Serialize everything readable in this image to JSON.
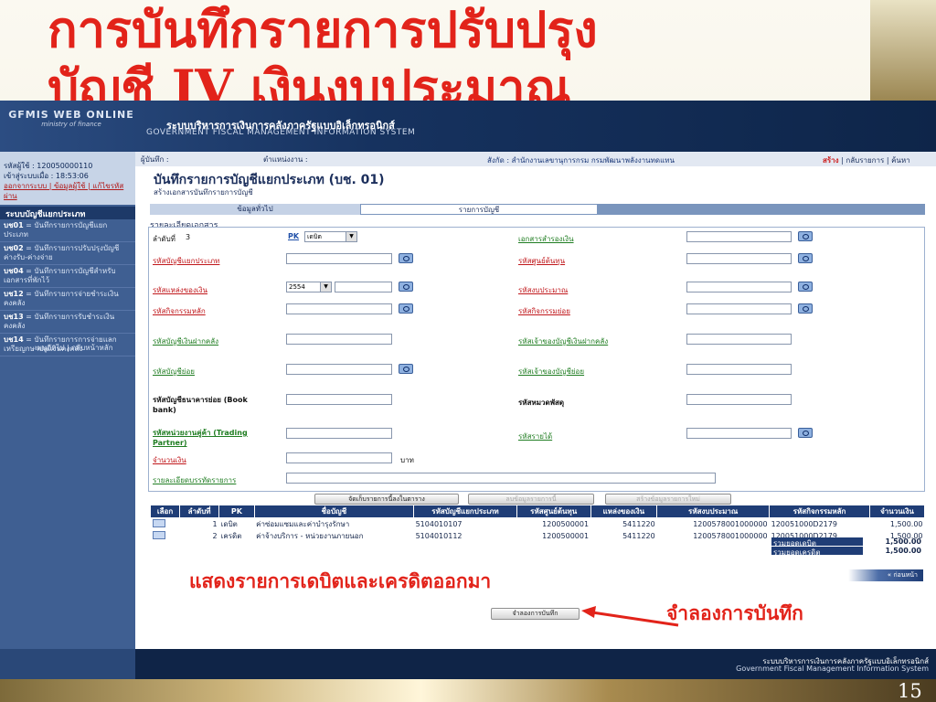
{
  "slide": {
    "title_line1": "การบันทึกรายการปรับปรุง",
    "title_line2": "บัญชี JV เงินงบประมาณ",
    "page_number": "15",
    "note_debit_credit": "แสดงรายการเดบิตและเครดิตออกมา",
    "note_simulate": "จำลองการบันทึก"
  },
  "header": {
    "logo_main": "GFMIS WEB ONLINE",
    "logo_sub": "ministry of finance",
    "system_th": "ระบบบริหารการเงินการคลังภาครัฐแบบอิเล็กทรอนิกส์",
    "system_en": "GOVERNMENT FISCAL MANAGEMENT INFORMATION SYSTEM"
  },
  "sidebar": {
    "user_label": "รหัสผู้ใช้ : 120050000110",
    "login_time": "เข้าสู่ระบบเมื่อ : 18:53:06",
    "links": "ออกจากระบบ | ข้อมูลผู้ใช้ | แก้ไขรหัสผ่าน",
    "heading": "ระบบบัญชีแยกประเภท",
    "menu": [
      {
        "code": "บช01",
        "label": "บันทึกรายการบัญชีแยกประเภท"
      },
      {
        "code": "บช02",
        "label": "บันทึกรายการปรับปรุงบัญชีค่างรับ-ค่างจ่าย"
      },
      {
        "code": "บช04",
        "label": "บันทึกรายการบัญชีสำหรับเอกสารที่พักไว้"
      },
      {
        "code": "บช12",
        "label": "บันทึกรายการจ่ายชำระเงินคงคลัง"
      },
      {
        "code": "บช13",
        "label": "บันทึกรายการรับชำระเงินคงคลัง"
      },
      {
        "code": "บช14",
        "label": "บันทึกรายการการจ่ายแลกเหรียญกษาปณ์เงินคงคลัง"
      }
    ],
    "footer": "เมนูถัดไป | กลับหน้าหลัก"
  },
  "crumb": {
    "user_field": "ผู้บันทึก :",
    "position_field": "ตำแหน่งงาน :",
    "org": "สังกัด : สำนักงานเลขานุการกรม กรมพัฒนาพลังงานทดแทน",
    "actions_create": "สร้าง",
    "actions_rest": "| กลับรายการ | ค้นหา"
  },
  "form": {
    "title": "บันทึกรายการบัญชีแยกประเภท (บช. 01)",
    "subtitle": "สร้างเอกสารบันทึกรายการบัญชี",
    "tab_general": "ข้อมูลทั่วไป",
    "tab_items": "รายการบัญชี",
    "section": "รายละเอียดเอกสาร",
    "seq_label": "ลำดับที่",
    "seq_value": "3",
    "pk_label": "PK",
    "pk_value": "เดบิต",
    "doc_ref_label": "เอกสารสำรองเงิน",
    "gl_label": "รหัสบัญชีแยกประเภท",
    "cost_center_label": "รหัสศูนย์ต้นทุน",
    "fund_source_label": "รหัสแหล่งของเงิน",
    "fund_year": "2554",
    "budget_label": "รหัสงบประมาณ",
    "main_activity_label": "รหัสกิจกรรมหลัก",
    "sub_activity_label": "รหัสกิจกรรมย่อย",
    "treasury_label": "รหัสบัญชีเงินฝากคลัง",
    "treasury_owner_label": "รหัสเจ้าของบัญชีเงินฝากคลัง",
    "sub_account_label": "รหัสบัญชีย่อย",
    "sub_account_owner_label": "รหัสเจ้าของบัญชีย่อย",
    "bank_account_label": "รหัสบัญชีธนาคารย่อย (Book bank)",
    "asset_label": "รหัสหมวดพัสดุ",
    "trading_partner_label": "รหัสหน่วยงานคู่ค้า (Trading Partner)",
    "revenue_label": "รหัสรายได้",
    "amount_label": "จำนวนเงิน",
    "amount_unit": "บาท",
    "description_label": "รายละเอียดบรรทัดรายการ",
    "btn_save_line": "จัดเก็บรายการนี้ลงในตาราง",
    "btn_delete_line": "ลบข้อมูลรายการนี้",
    "btn_new_line": "สร้างข้อมูลรายการใหม่"
  },
  "grid": {
    "headers": [
      "เลือก",
      "ลำดับที่",
      "PK",
      "ชื่อบัญชี",
      "รหัสบัญชีแยกประเภท",
      "รหัสศูนย์ต้นทุน",
      "แหล่งของเงิน",
      "รหัสงบประมาณ",
      "รหัสกิจกรรมหลัก",
      "จำนวนเงิน"
    ],
    "rows": [
      {
        "seq": "1",
        "pk": "เดบิต",
        "name": "ค่าซ่อมแซมและค่าบำรุงรักษา",
        "gl": "5104010107",
        "cc": "1200500001",
        "fund": "5411220",
        "budget": "1200578001000000",
        "activity": "120051000D2179",
        "amount": "1,500.00"
      },
      {
        "seq": "2",
        "pk": "เครดิต",
        "name": "ค่าจ้างบริการ - หน่วยงานภายนอก",
        "gl": "5104010112",
        "cc": "1200500001",
        "fund": "5411220",
        "budget": "1200578001000000",
        "activity": "120051000D2179",
        "amount": "1,500.00"
      }
    ],
    "total_debit_label": "รวมยอดเดบิต",
    "total_debit_value": "1,500.00",
    "total_credit_label": "รวมยอดเครดิต",
    "total_credit_value": "1,500.00",
    "next_label": "« ก่อนหน้า"
  },
  "buttons": {
    "simulate": "จำลองการบันทึก"
  },
  "footer": {
    "th": "ระบบบริหารการเงินการคลังภาครัฐแบบอิเล็กทรอนิกส์",
    "en": "Government Fiscal Management Information System"
  },
  "colors": {
    "title_red": "#e2231a",
    "header_navy": "#16325f",
    "accent_blue": "#1f3d76"
  }
}
